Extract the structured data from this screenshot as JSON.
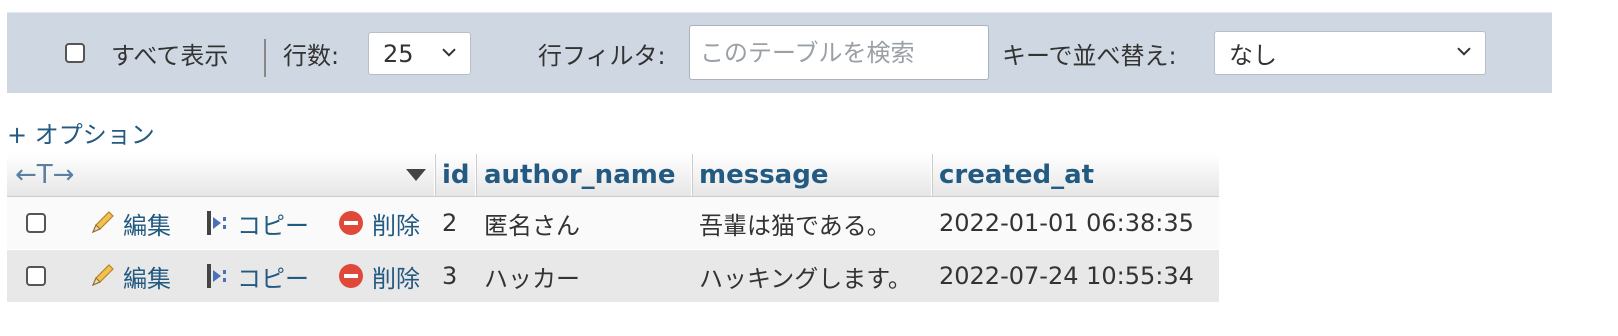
{
  "filterbar": {
    "show_all_label": "すべて表示",
    "rows_label": "行数:",
    "rows_value": "25",
    "row_filter_label": "行フィルタ:",
    "search_placeholder": "このテーブルを検索",
    "sort_label": "キーで並べ替え:",
    "sort_value": "なし"
  },
  "options_link": "+ オプション",
  "table": {
    "nav_arrows": "←T→",
    "columns": [
      "id",
      "author_name",
      "message",
      "created_at"
    ],
    "action_labels": {
      "edit": "編集",
      "copy": "コピー",
      "delete": "削除"
    },
    "rows": [
      {
        "id": "2",
        "author_name": "匿名さん",
        "message": "吾輩は猫である。",
        "created_at": "2022-01-01 06:38:35"
      },
      {
        "id": "3",
        "author_name": "ハッカー",
        "message": "ハッキングします。",
        "created_at": "2022-07-24 10:55:34"
      }
    ]
  },
  "colors": {
    "bar_bg": "#cfd8e2",
    "link": "#235a81",
    "delete_red": "#e0493a"
  }
}
